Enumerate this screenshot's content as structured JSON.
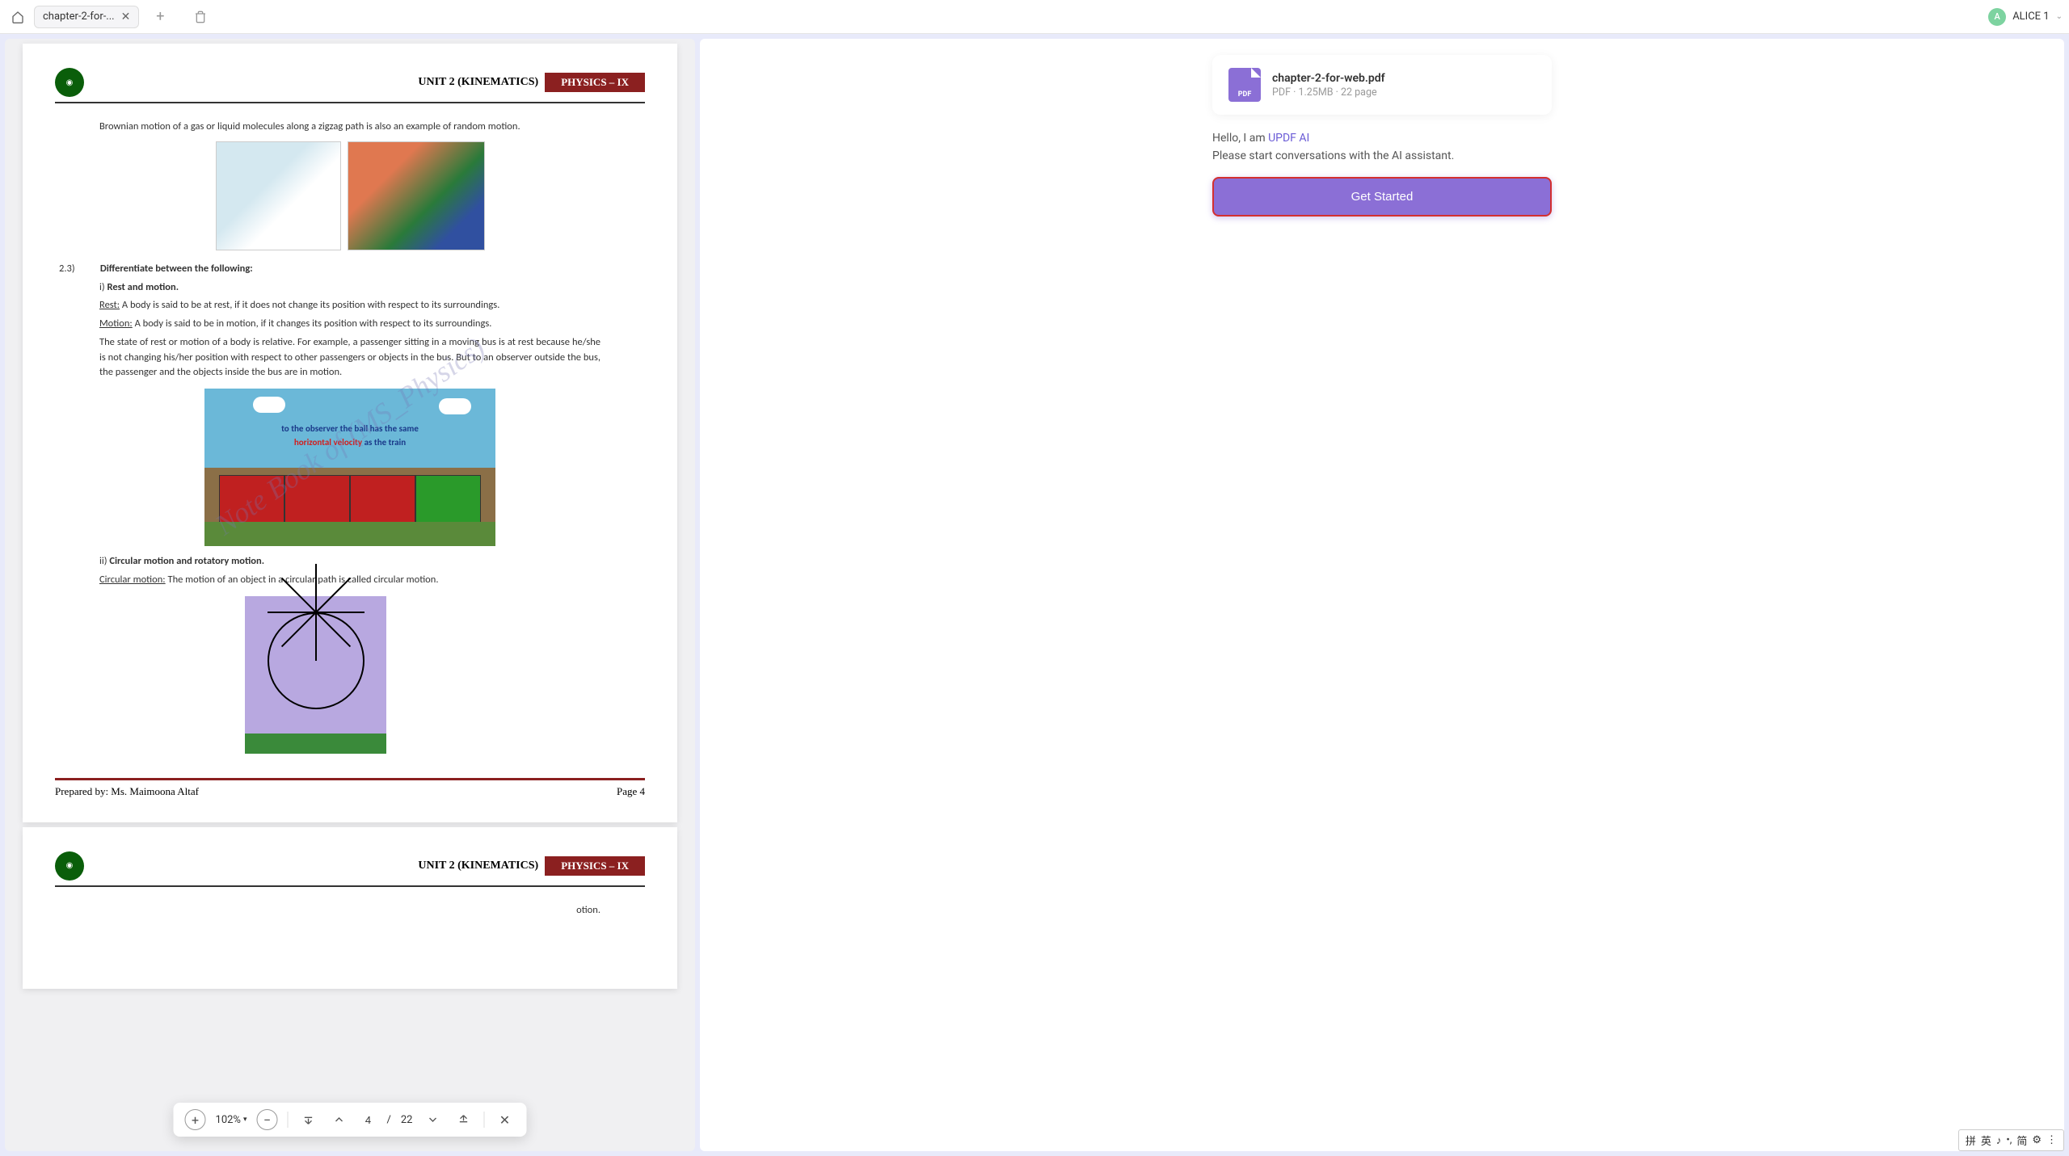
{
  "topbar": {
    "tab_title": "chapter-2-for-...",
    "username": "ALICE 1",
    "avatar_letter": "A"
  },
  "pdf": {
    "header": {
      "unit": "UNIT 2 (KINEMATICS)",
      "subject": "PHYSICS – IX"
    },
    "p1": "Brownian motion of a gas or liquid molecules along a zigzag path is also an example of random motion.",
    "q_num": "2.3)",
    "q_title": "Differentiate between the following:",
    "sub_i": "i) ",
    "sub_i_title": "Rest and motion.",
    "rest_label": "Rest:",
    "rest_text": " A body is said to be at rest, if it does not change its position with respect to its surroundings.",
    "motion_label": "Motion:",
    "motion_text": " A body is said to be in motion, if it changes its position with respect to its surroundings.",
    "rel_text": "The state of rest or motion of a body is relative. For example, a passenger sitting in a moving bus is at rest because he/she is not changing his/her position with respect to other passengers or objects in the bus. But to an observer outside the bus, the passenger and the objects inside the bus are in motion.",
    "train_line1": "to the observer the ball has the same",
    "train_line2_a": "horizontal velocity",
    "train_line2_b": " as the train",
    "sub_ii": "ii) ",
    "sub_ii_title": "Circular motion and rotatory motion.",
    "circ_label": "Circular motion:",
    "circ_text": " The motion of an object in a circular path is called circular motion.",
    "watermark": "Note Book of (MS_Physics)",
    "footer_left": "Prepared by: Ms. Maimoona Altaf",
    "footer_right": "Page 4",
    "next_page_snippet": "otion."
  },
  "toolbar": {
    "zoom": "102%",
    "page_current": "4",
    "page_sep": "/",
    "page_total": "22"
  },
  "chat": {
    "file": {
      "name": "chapter-2-for-web.pdf",
      "meta": "PDF · 1.25MB · 22 page",
      "icon_label": "PDF"
    },
    "greeting_prefix": "Hello, I am ",
    "brand": "UPDF AI",
    "greeting_line2": "Please start conversations with the AI assistant.",
    "cta": "Get Started"
  },
  "ime": {
    "items": [
      "拼",
      "英",
      "♪",
      "•,",
      "简",
      "⚙",
      "⋮"
    ]
  }
}
